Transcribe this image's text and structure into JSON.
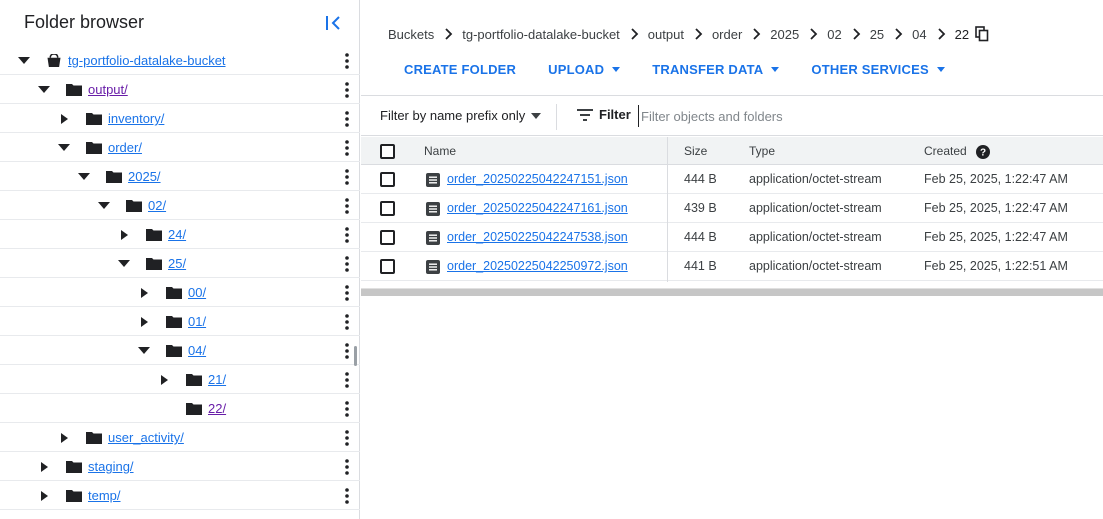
{
  "folder_panel": {
    "title": "Folder browser",
    "tree": [
      {
        "label": "tg-portfolio-datalake-bucket",
        "depth": 0,
        "expanded": true,
        "type": "bucket"
      },
      {
        "label": "output/",
        "depth": 1,
        "expanded": true,
        "type": "folder",
        "visited": true
      },
      {
        "label": "inventory/",
        "depth": 2,
        "expanded": false,
        "type": "folder"
      },
      {
        "label": "order/",
        "depth": 2,
        "expanded": true,
        "type": "folder"
      },
      {
        "label": "2025/",
        "depth": 3,
        "expanded": true,
        "type": "folder"
      },
      {
        "label": "02/",
        "depth": 4,
        "expanded": true,
        "type": "folder"
      },
      {
        "label": "24/",
        "depth": 5,
        "expanded": false,
        "type": "folder"
      },
      {
        "label": "25/",
        "depth": 5,
        "expanded": true,
        "type": "folder"
      },
      {
        "label": "00/",
        "depth": 6,
        "expanded": false,
        "type": "folder"
      },
      {
        "label": "01/",
        "depth": 6,
        "expanded": false,
        "type": "folder"
      },
      {
        "label": "04/",
        "depth": 6,
        "expanded": true,
        "type": "folder"
      },
      {
        "label": "21/",
        "depth": 7,
        "expanded": false,
        "type": "folder"
      },
      {
        "label": "22/",
        "depth": 7,
        "expanded": null,
        "type": "folder",
        "visited": true
      },
      {
        "label": "user_activity/",
        "depth": 2,
        "expanded": false,
        "type": "folder"
      },
      {
        "label": "staging/",
        "depth": 1,
        "expanded": false,
        "type": "folder"
      },
      {
        "label": "temp/",
        "depth": 1,
        "expanded": false,
        "type": "folder"
      }
    ]
  },
  "breadcrumb": [
    "Buckets",
    "tg-portfolio-datalake-bucket",
    "output",
    "order",
    "2025",
    "02",
    "25",
    "04",
    "22"
  ],
  "actions": [
    {
      "label": "CREATE FOLDER",
      "dropdown": false
    },
    {
      "label": "UPLOAD",
      "dropdown": true
    },
    {
      "label": "TRANSFER DATA",
      "dropdown": true
    },
    {
      "label": "OTHER SERVICES",
      "dropdown": true
    }
  ],
  "filter": {
    "mode": "Filter by name prefix only",
    "button": "Filter",
    "placeholder": "Filter objects and folders"
  },
  "table": {
    "headers": {
      "name": "Name",
      "size": "Size",
      "type": "Type",
      "created": "Created"
    },
    "rows": [
      {
        "name": "order_20250225042247151.json",
        "size": "444 B",
        "type": "application/octet-stream",
        "created": "Feb 25, 2025, 1:22:47 AM"
      },
      {
        "name": "order_20250225042247161.json",
        "size": "439 B",
        "type": "application/octet-stream",
        "created": "Feb 25, 2025, 1:22:47 AM"
      },
      {
        "name": "order_20250225042247538.json",
        "size": "444 B",
        "type": "application/octet-stream",
        "created": "Feb 25, 2025, 1:22:47 AM"
      },
      {
        "name": "order_20250225042250972.json",
        "size": "441 B",
        "type": "application/octet-stream",
        "created": "Feb 25, 2025, 1:22:51 AM"
      }
    ]
  },
  "colors": {
    "link": "#1a73e8",
    "visited": "#681da8",
    "border": "#dadce0"
  }
}
